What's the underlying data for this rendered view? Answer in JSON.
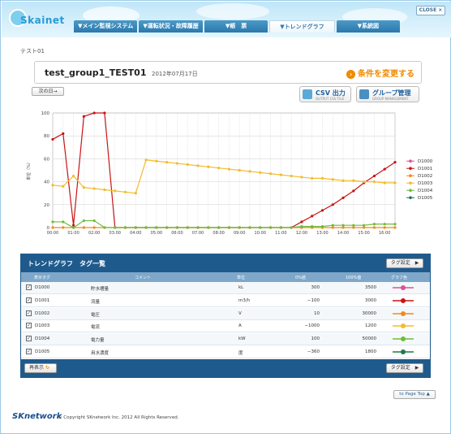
{
  "window": {
    "close_label": "CLOSE ×"
  },
  "logo": {
    "text": "Skainet"
  },
  "nav": {
    "tabs": [
      {
        "label": "▼メイン監視システム",
        "active": false
      },
      {
        "label": "▼運転状況・故障履歴",
        "active": false
      },
      {
        "label": "▼帳　票",
        "active": false
      },
      {
        "label": "▼トレンドグラフ",
        "active": true
      },
      {
        "label": "▼系統図",
        "active": false
      }
    ]
  },
  "page": {
    "breadcrumb": "テスト01",
    "title": "test_group1_TEST01",
    "date": "2012年07月17日",
    "change_condition": "条件を変更する",
    "next_day": "次の日→",
    "csv": {
      "label": "CSV 出力",
      "sub": "OUTPUT CSV FILE"
    },
    "group": {
      "label": "グループ管理",
      "sub": "GROUP MANAGEMENT"
    }
  },
  "chart_data": {
    "type": "line",
    "ylabel": "単位（%）",
    "ylim": [
      0,
      100
    ],
    "yticks": [
      "0",
      "20",
      "40",
      "60",
      "80",
      "100"
    ],
    "x": [
      "00:00",
      "00:30",
      "01:00",
      "01:30",
      "02:00",
      "02:30",
      "03:00",
      "03:30",
      "04:00",
      "04:30",
      "05:00",
      "05:30",
      "06:00",
      "06:30",
      "07:00",
      "07:30",
      "08:00",
      "08:30",
      "09:00",
      "09:30",
      "10:00",
      "10:30",
      "11:00",
      "11:30",
      "12:00",
      "12:30",
      "13:00",
      "13:30",
      "14:00",
      "14:30",
      "15:00",
      "15:30",
      "16:00",
      "16:30"
    ],
    "xticks": [
      "00:00",
      "01:00",
      "02:00",
      "03:00",
      "04:00",
      "05:00",
      "06:00",
      "07:00",
      "08:00",
      "09:00",
      "10:00",
      "11:00",
      "12:00",
      "13:00",
      "14:00",
      "15:00",
      "16:00"
    ],
    "series": [
      {
        "name": "D1000",
        "color": "#e0508c",
        "values": [
          null,
          null,
          null,
          null,
          null,
          null,
          null,
          null,
          null,
          null,
          null,
          null,
          null,
          null,
          null,
          null,
          null,
          null,
          null,
          null,
          null,
          null,
          null,
          null,
          null,
          null,
          null,
          null,
          null,
          null,
          null,
          null,
          null,
          null
        ]
      },
      {
        "name": "D1001",
        "color": "#c81414",
        "values": [
          77,
          82,
          2,
          97,
          100,
          100,
          0,
          0,
          0,
          0,
          0,
          0,
          0,
          0,
          0,
          0,
          0,
          0,
          0,
          0,
          0,
          0,
          0,
          0,
          5,
          10,
          15,
          20,
          26,
          32,
          39,
          45,
          51,
          57
        ]
      },
      {
        "name": "D1002",
        "color": "#f08a1c",
        "values": [
          0,
          0,
          0,
          0,
          0,
          0,
          0,
          0,
          0,
          0,
          0,
          0,
          0,
          0,
          0,
          0,
          0,
          0,
          0,
          0,
          0,
          0,
          0,
          0,
          0,
          0,
          0,
          0,
          0,
          0,
          0,
          0,
          0,
          0
        ]
      },
      {
        "name": "D1003",
        "color": "#f2bc2c",
        "values": [
          37,
          36,
          45,
          35,
          34,
          33,
          32,
          31,
          30,
          59,
          58,
          57,
          56,
          55,
          54,
          53,
          52,
          51,
          50,
          49,
          48,
          47,
          46,
          45,
          44,
          43,
          43,
          42,
          41,
          41,
          40,
          40,
          39,
          39
        ]
      },
      {
        "name": "D1004",
        "color": "#6cbd3c",
        "values": [
          5,
          5,
          0,
          6,
          6,
          0,
          0,
          0,
          0,
          0,
          0,
          0,
          0,
          0,
          0,
          0,
          0,
          0,
          0,
          0,
          0,
          0,
          0,
          0,
          1,
          1,
          1,
          2,
          2,
          2,
          2,
          3,
          3,
          3
        ]
      },
      {
        "name": "D1005",
        "color": "#1e7a4a",
        "values": [
          null,
          null,
          null,
          null,
          null,
          null,
          null,
          null,
          null,
          null,
          null,
          null,
          null,
          null,
          null,
          null,
          null,
          null,
          null,
          null,
          null,
          null,
          null,
          null,
          null,
          null,
          null,
          null,
          null,
          null,
          null,
          null,
          null,
          null
        ]
      }
    ]
  },
  "table": {
    "title": "トレンドグラフ　タグ一覧",
    "tag_setting": "タグ設定　▶",
    "redisplay": "再表示",
    "redisplay_icon": "refresh-icon",
    "headers": {
      "tag": "表示タグ",
      "comment": "コメント",
      "unit": "単位",
      "zero": "0%値",
      "hundred": "100%値",
      "color": "グラフ色"
    },
    "rows": [
      {
        "tag": "D1000",
        "comment": "貯水槽量",
        "unit": "kL",
        "zero": "300",
        "hundred": "3500",
        "color": "#e0508c"
      },
      {
        "tag": "D1001",
        "comment": "流量",
        "unit": "m3/h",
        "zero": "−100",
        "hundred": "3000",
        "color": "#c81414"
      },
      {
        "tag": "D1002",
        "comment": "電圧",
        "unit": "V",
        "zero": "10",
        "hundred": "30000",
        "color": "#f08a1c"
      },
      {
        "tag": "D1003",
        "comment": "電流",
        "unit": "A",
        "zero": "−1000",
        "hundred": "1200",
        "color": "#f2bc2c"
      },
      {
        "tag": "D1004",
        "comment": "電力量",
        "unit": "kW",
        "zero": "100",
        "hundred": "50000",
        "color": "#6cbd3c"
      },
      {
        "tag": "D1005",
        "comment": "用水濃度",
        "unit": "度",
        "zero": "−360",
        "hundred": "1800",
        "color": "#1e7a4a"
      }
    ]
  },
  "page_top": "to Page Top ▲",
  "footer": {
    "logo": "SKnetwork",
    "copyright": "© Copyright SKnetwork Inc. 2012 All Rights Reserved."
  }
}
